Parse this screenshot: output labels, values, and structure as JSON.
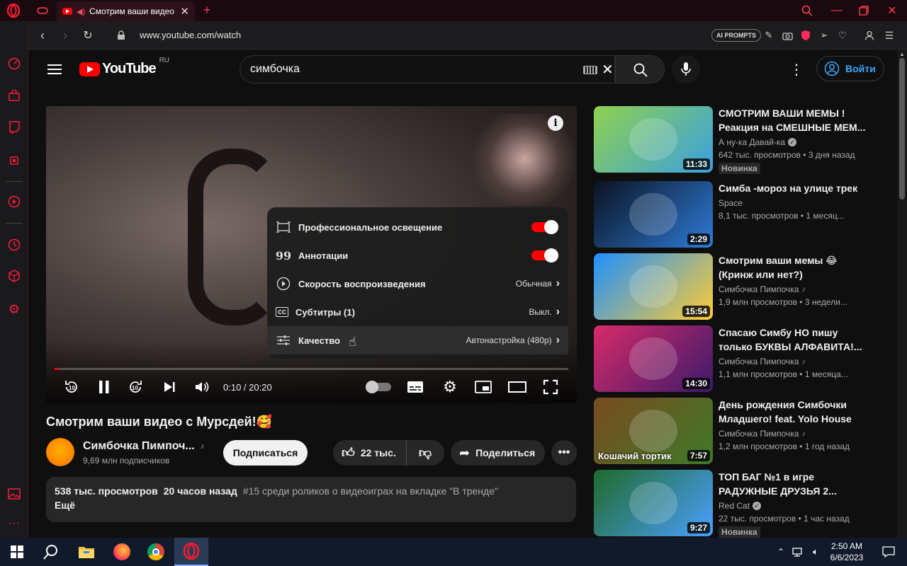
{
  "browser": {
    "tab_title": "Смотрим ваши видео с Мурсдей!",
    "url": "www.youtube.com/watch",
    "ai_prompts_label": "AI PROMPTS"
  },
  "youtube": {
    "logo_text": "YouTube",
    "region": "RU",
    "search_value": "симбочка",
    "signin_label": "Войти"
  },
  "player": {
    "time": "0:10 / 20:20",
    "progress": 0.008,
    "menu": [
      {
        "label": "Профессиональное освещение",
        "type": "toggle",
        "icon": "lighting-icon"
      },
      {
        "label": "Аннотации",
        "type": "toggle",
        "icon": "annotations-icon"
      },
      {
        "label": "Скорость воспроизведения",
        "value": "Обычная",
        "icon": "speed-icon"
      },
      {
        "label": "Субтитры (1)",
        "value": "Выкл.",
        "icon": "subtitles-icon"
      },
      {
        "label": "Качество",
        "value": "Автонастройка (480p)",
        "icon": "quality-icon"
      }
    ]
  },
  "video": {
    "title": "Смотрим ваши видео с Мурсдей!🥰",
    "channel": "Симбочка Пимпоч...",
    "subscribers": "9,69 млн подписчиков",
    "subscribe_label": "Подписаться",
    "likes": "22 тыс.",
    "share_label": "Поделиться",
    "views": "538 тыс. просмотров",
    "published": "20 часов назад",
    "trending": "#15 среди роликов о видеоиграх на вкладке \"В тренде\"",
    "more_label": "Ещё"
  },
  "recommendations": [
    {
      "title": "СМОТРИМ ВАШИ МЕМЫ ! Реакция на СМЕШНЫЕ МЕМ...",
      "channel": "А ну-ка Давай-ка",
      "verified": "check",
      "meta": "642 тыс. просмотров • 3 дня назад",
      "badge": "Новинка",
      "duration": "11:33",
      "colors": [
        "#8fd14f",
        "#3aa0e0"
      ]
    },
    {
      "title": "Симба -мороз на улице трек",
      "channel": "Space",
      "verified": "",
      "meta": "8,1 тыс. просмотров • 1 месяц...",
      "badge": "",
      "duration": "2:29",
      "colors": [
        "#0b1220",
        "#2e7bd6"
      ]
    },
    {
      "title": "Смотрим ваши мемы 😂 (Кринж или нет?)",
      "channel": "Симбочка Пимпочка",
      "verified": "note",
      "meta": "1,9 млн просмотров • 3 недели...",
      "badge": "",
      "duration": "15:54",
      "colors": [
        "#1e90ff",
        "#ffcc33"
      ]
    },
    {
      "title": "Спасаю Симбу НО пишу только БУКВЫ АЛФАВИТА!...",
      "channel": "Симбочка Пимпочка",
      "verified": "note",
      "meta": "1,1 млн просмотров • 1 месяца...",
      "badge": "",
      "duration": "14:30",
      "colors": [
        "#d92a6a",
        "#3a1a6a"
      ]
    },
    {
      "title": "День рождения Симбочки Младшего! feat. Yolo House",
      "channel": "Симбочка Пимпочка",
      "verified": "note",
      "meta": "1,2 млн просмотров • 1 год назад",
      "badge": "",
      "duration": "7:57",
      "overlay": "Кошачий тортик",
      "colors": [
        "#7a4a20",
        "#3e7a2a"
      ]
    },
    {
      "title": "ТОП БАГ №1 в игре РАДУЖНЫЕ ДРУЗЬЯ 2...",
      "channel": "Red Cat",
      "verified": "check",
      "meta": "22 тыс. просмотров • 1 час назад",
      "badge": "Новинка",
      "duration": "9:27",
      "colors": [
        "#1f6a2a",
        "#4aa0ff"
      ]
    }
  ],
  "taskbar": {
    "time": "2:50 AM",
    "date": "6/6/2023"
  }
}
